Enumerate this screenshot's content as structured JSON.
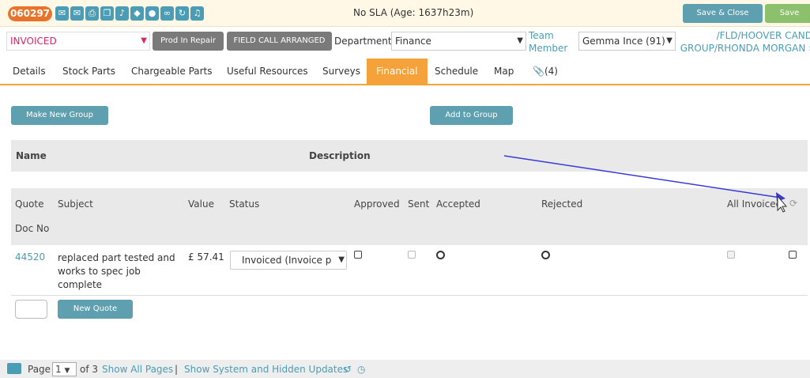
{
  "header": {
    "job_number": "060297",
    "sla": "No SLA (Age: 1637h23m)",
    "save_close_label": "Save & Close",
    "save_label": "Save",
    "icons": [
      "mail-icon",
      "envelope-icon",
      "print-icon",
      "copy-icon",
      "music-icon",
      "shield-icon",
      "location-icon",
      "link-icon",
      "refresh-icon",
      "bell-icon"
    ]
  },
  "job_bar": {
    "status": "INVOICED",
    "btn_prod_repair": "Prod In Repair",
    "btn_field_call": "FIELD CALL ARRANGED",
    "department_label": "Department",
    "department_value": "Finance",
    "team_label_1": "Team",
    "team_label_2": "Member",
    "team_value": "Gemma Ince (91)",
    "customer_line1": "/FLD/HOOVER CAND",
    "customer_line2": "GROUP/RHONDA MORGAN",
    "customer_arrow": "›"
  },
  "tabs": [
    {
      "label": "Details"
    },
    {
      "label": "Stock Parts"
    },
    {
      "label": "Chargeable Parts"
    },
    {
      "label": "Useful Resources"
    },
    {
      "label": "Surveys"
    },
    {
      "label": "Financial"
    },
    {
      "label": "Schedule"
    },
    {
      "label": "Map"
    },
    {
      "label": "(4)"
    }
  ],
  "financial": {
    "make_new_group": "Make New Group",
    "add_to_group": "Add to Group",
    "group_columns": {
      "name": "Name",
      "description": "Description"
    },
    "quote_columns": {
      "quote": "Quote",
      "doc_no": "Doc No",
      "subject": "Subject",
      "value": "Value",
      "status": "Status",
      "approved": "Approved",
      "sent": "Sent",
      "accepted": "Accepted",
      "rejected": "Rejected",
      "all_invoiced": "All Invoiced"
    },
    "rows": [
      {
        "doc_no": "44520",
        "subject_1": "replaced part tested and",
        "subject_2": "works to spec job",
        "subject_3": "complete",
        "value": "£ 57.41",
        "status": "Invoiced (Invoice p"
      }
    ],
    "new_quote": "New Quote"
  },
  "footer": {
    "page_label": "Page",
    "page_value": "1",
    "of_label": "of 3",
    "show_all_pages": "Show All Pages",
    "separator": "|",
    "show_hidden": "Show System and Hidden Updates"
  },
  "colors": {
    "accent_orange": "#f5a23a",
    "teal": "#5e9fb0",
    "save_green": "#8cc06c",
    "status_pink": "#d6286b",
    "annotation_arrow": "#3a3ad6"
  }
}
